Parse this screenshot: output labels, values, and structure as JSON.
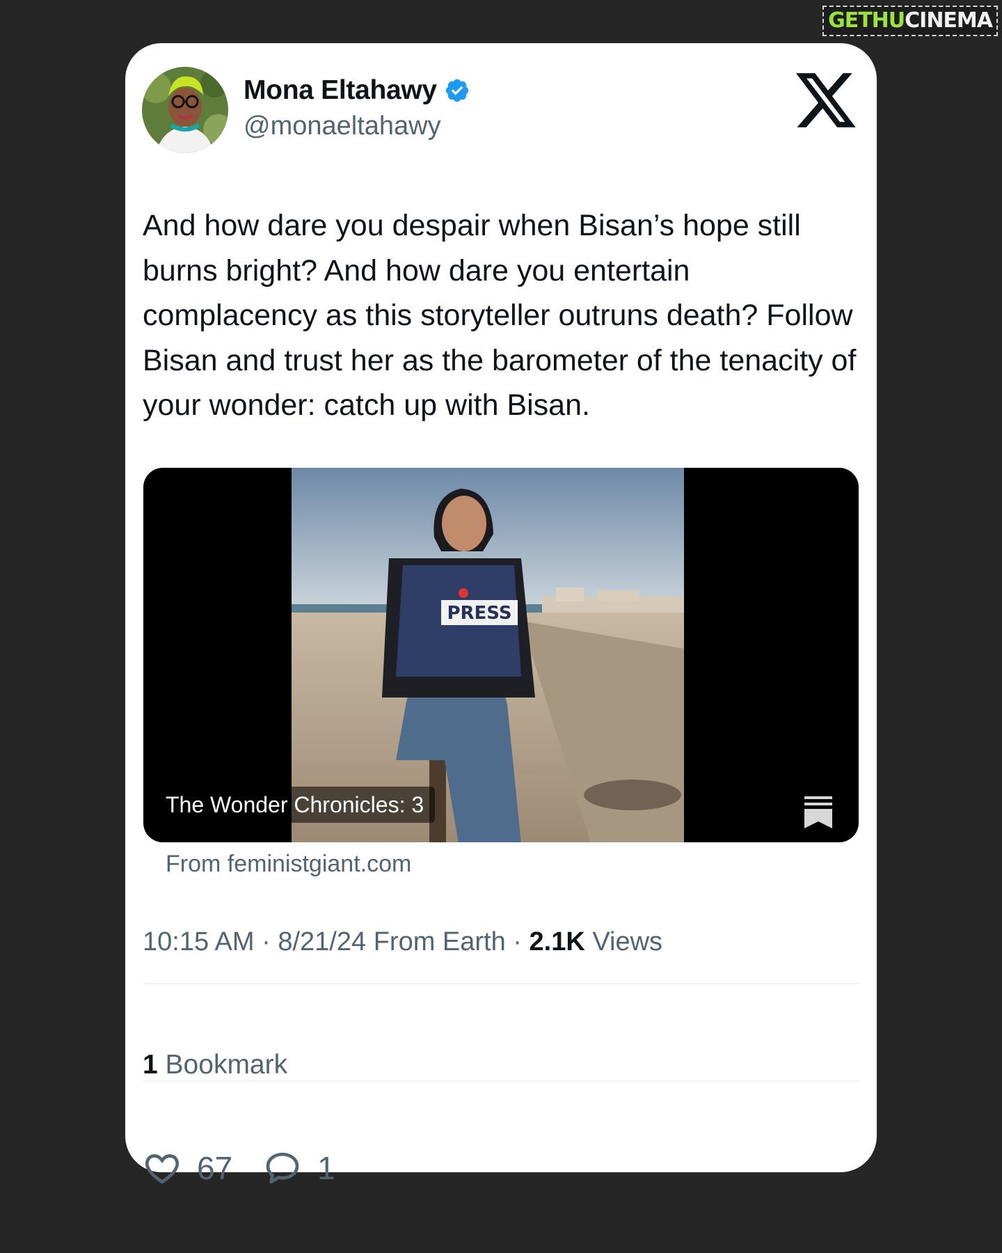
{
  "watermark": {
    "part1": "GETHU",
    "part2": "CINEMA"
  },
  "tweet": {
    "author_name": "Mona Eltahawy",
    "handle": "@monaeltahawy",
    "text": "And how dare you despair when Bisan’s hope still burns bright? And how dare you entertain complacency as this storyteller outruns death? Follow Bisan and trust her as the barometer of the tenacity of your wonder: catch up with Bisan.",
    "media": {
      "caption": "The Wonder Chronicles: 3",
      "vest_label": "PRESS"
    },
    "link_source": "From feministgiant.com",
    "meta": {
      "time": "10:15 AM",
      "date": "8/21/24",
      "location": "From Earth",
      "views_count": "2.1K",
      "views_label": "Views"
    },
    "bookmarks": {
      "count": "1",
      "label": "Bookmark"
    },
    "actions": {
      "likes": "67",
      "replies": "1"
    }
  },
  "colors": {
    "background": "#262626",
    "card": "#ffffff",
    "text_primary": "#0f1419",
    "text_secondary": "#536471",
    "verified": "#1d9bf0"
  },
  "icons": [
    "verified-icon",
    "x-logo-icon",
    "bookmark-icon",
    "heart-icon",
    "reply-icon"
  ]
}
